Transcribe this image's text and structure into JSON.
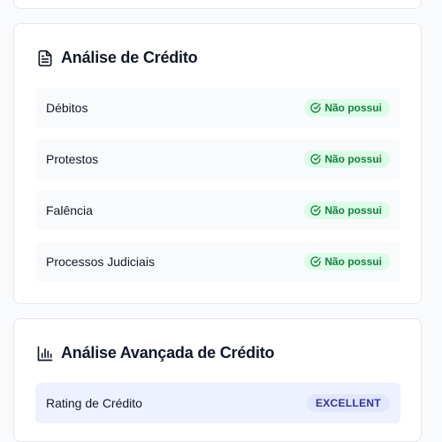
{
  "credit_analysis": {
    "title": "Análise de Crédito",
    "icon": "document-icon",
    "items": [
      {
        "label": "Débitos",
        "status": "Não possui"
      },
      {
        "label": "Protestos",
        "status": "Não possui"
      },
      {
        "label": "Falência",
        "status": "Não possui"
      },
      {
        "label": "Processos Judiciais",
        "status": "Não possui"
      }
    ]
  },
  "advanced_credit_analysis": {
    "title": "Análise Avançada de Crédito",
    "icon": "bar-chart-icon",
    "rating": {
      "label": "Rating de Crédito",
      "value": "EXCELLENT"
    }
  },
  "colors": {
    "status_ok_bg": "#dcfce7",
    "status_ok_text": "#15803d",
    "rating_bg": "#e0e7ff",
    "rating_text": "#3730a3"
  }
}
